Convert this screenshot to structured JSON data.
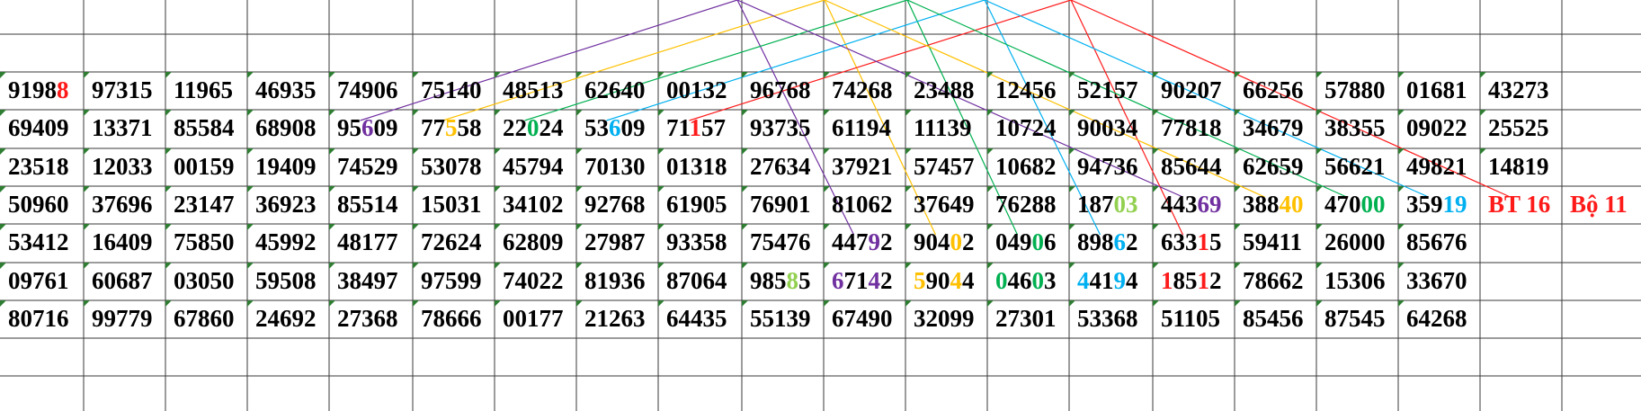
{
  "colors": {
    "red": "#ff1a1a",
    "purple": "#7030a0",
    "orange": "#ffc000",
    "green": "#00b050",
    "lightgreen": "#92d050",
    "cyan": "#00b0f0",
    "black": "#000000",
    "grid": "#3a3a3a"
  },
  "rows": [
    {
      "cells": [
        {
          "t": "91988",
          "hl": [
            [
              4,
              "red"
            ]
          ]
        },
        {
          "t": "97315"
        },
        {
          "t": "11965"
        },
        {
          "t": "46935"
        },
        {
          "t": "74906"
        },
        {
          "t": "75140"
        },
        {
          "t": "48513"
        },
        {
          "t": "62640"
        },
        {
          "t": "00132"
        },
        {
          "t": "96768"
        },
        {
          "t": "74268"
        },
        {
          "t": "23488"
        },
        {
          "t": "12456"
        },
        {
          "t": "52157"
        },
        {
          "t": "90207"
        },
        {
          "t": "66256"
        },
        {
          "t": "57880"
        },
        {
          "t": "01681"
        },
        {
          "t": "43273"
        }
      ]
    },
    {
      "cells": [
        {
          "t": "69409"
        },
        {
          "t": "13371"
        },
        {
          "t": "85584"
        },
        {
          "t": "68908"
        },
        {
          "t": "95609",
          "hl": [
            [
              2,
              "purple"
            ]
          ]
        },
        {
          "t": "77558",
          "hl": [
            [
              2,
              "orange"
            ]
          ]
        },
        {
          "t": "22024",
          "hl": [
            [
              2,
              "green"
            ]
          ]
        },
        {
          "t": "53609",
          "hl": [
            [
              2,
              "cyan"
            ]
          ]
        },
        {
          "t": "71157",
          "hl": [
            [
              2,
              "red"
            ]
          ]
        },
        {
          "t": "93735"
        },
        {
          "t": "61194"
        },
        {
          "t": "11139"
        },
        {
          "t": "10724"
        },
        {
          "t": "90034"
        },
        {
          "t": "77818"
        },
        {
          "t": "34679"
        },
        {
          "t": "38355"
        },
        {
          "t": "09022"
        },
        {
          "t": "25525"
        }
      ]
    },
    {
      "cells": [
        {
          "t": "23518"
        },
        {
          "t": "12033"
        },
        {
          "t": "00159"
        },
        {
          "t": "19409"
        },
        {
          "t": "74529"
        },
        {
          "t": "53078"
        },
        {
          "t": "45794"
        },
        {
          "t": "70130"
        },
        {
          "t": "01318"
        },
        {
          "t": "27634"
        },
        {
          "t": "37921"
        },
        {
          "t": "57457"
        },
        {
          "t": "10682"
        },
        {
          "t": "94736"
        },
        {
          "t": "85644"
        },
        {
          "t": "62659"
        },
        {
          "t": "56621"
        },
        {
          "t": "49821"
        },
        {
          "t": "14819"
        }
      ]
    },
    {
      "cells": [
        {
          "t": "50960"
        },
        {
          "t": "37696"
        },
        {
          "t": "23147"
        },
        {
          "t": "36923"
        },
        {
          "t": "85514"
        },
        {
          "t": "15031"
        },
        {
          "t": "34102"
        },
        {
          "t": "92768"
        },
        {
          "t": "61905"
        },
        {
          "t": "76901"
        },
        {
          "t": "81062"
        },
        {
          "t": "37649"
        },
        {
          "t": "76288"
        },
        {
          "t": "18703",
          "hl": [
            [
              3,
              "lightgreen"
            ],
            [
              4,
              "lightgreen"
            ]
          ]
        },
        {
          "t": "44369",
          "hl": [
            [
              3,
              "purple"
            ],
            [
              4,
              "purple"
            ]
          ]
        },
        {
          "t": "38840",
          "hl": [
            [
              3,
              "orange"
            ],
            [
              4,
              "orange"
            ]
          ]
        },
        {
          "t": "47000",
          "hl": [
            [
              3,
              "green"
            ],
            [
              4,
              "green"
            ]
          ]
        },
        {
          "t": "35919",
          "hl": [
            [
              3,
              "cyan"
            ],
            [
              4,
              "cyan"
            ]
          ]
        },
        {
          "t": "BT 16",
          "red": true
        },
        {
          "t": "Bộ 11",
          "red": true
        }
      ]
    },
    {
      "cells": [
        {
          "t": "53412"
        },
        {
          "t": "16409"
        },
        {
          "t": "75850"
        },
        {
          "t": "45992"
        },
        {
          "t": "48177"
        },
        {
          "t": "72624"
        },
        {
          "t": "62809"
        },
        {
          "t": "27987"
        },
        {
          "t": "93358"
        },
        {
          "t": "75476"
        },
        {
          "t": "44792",
          "hl": [
            [
              3,
              "purple"
            ]
          ]
        },
        {
          "t": "90402",
          "hl": [
            [
              3,
              "orange"
            ]
          ]
        },
        {
          "t": "04906",
          "hl": [
            [
              3,
              "green"
            ]
          ]
        },
        {
          "t": "89862",
          "hl": [
            [
              3,
              "cyan"
            ]
          ]
        },
        {
          "t": "63315",
          "hl": [
            [
              3,
              "red"
            ]
          ]
        },
        {
          "t": "59411"
        },
        {
          "t": "26000"
        },
        {
          "t": "85676"
        }
      ]
    },
    {
      "cells": [
        {
          "t": "09761"
        },
        {
          "t": "60687"
        },
        {
          "t": "03050"
        },
        {
          "t": "59508"
        },
        {
          "t": "38497"
        },
        {
          "t": "97599"
        },
        {
          "t": "74022"
        },
        {
          "t": "81936"
        },
        {
          "t": "87064"
        },
        {
          "t": "98585",
          "hl": [
            [
              3,
              "lightgreen"
            ]
          ]
        },
        {
          "t": "67142",
          "hl": [
            [
              0,
              "purple"
            ],
            [
              3,
              "purple"
            ]
          ]
        },
        {
          "t": "59044",
          "hl": [
            [
              0,
              "orange"
            ],
            [
              3,
              "orange"
            ]
          ]
        },
        {
          "t": "04603",
          "hl": [
            [
              0,
              "green"
            ],
            [
              3,
              "green"
            ]
          ]
        },
        {
          "t": "44194",
          "hl": [
            [
              0,
              "cyan"
            ],
            [
              3,
              "cyan"
            ]
          ]
        },
        {
          "t": "18512",
          "hl": [
            [
              0,
              "red"
            ],
            [
              3,
              "red"
            ]
          ]
        },
        {
          "t": "78662"
        },
        {
          "t": "15306"
        },
        {
          "t": "33670"
        }
      ]
    },
    {
      "cells": [
        {
          "t": "80716"
        },
        {
          "t": "99779"
        },
        {
          "t": "67860"
        },
        {
          "t": "24692"
        },
        {
          "t": "27368"
        },
        {
          "t": "78666"
        },
        {
          "t": "00177"
        },
        {
          "t": "21263"
        },
        {
          "t": "64435"
        },
        {
          "t": "55139"
        },
        {
          "t": "67490"
        },
        {
          "t": "32099"
        },
        {
          "t": "27301"
        },
        {
          "t": "53368"
        },
        {
          "t": "51105"
        },
        {
          "t": "85456"
        },
        {
          "t": "87545"
        },
        {
          "t": "64268"
        }
      ]
    }
  ],
  "connectors": [
    {
      "color": "purple",
      "apex": 0,
      "targets": [
        [
          1,
          4
        ],
        [
          4,
          10
        ]
      ]
    },
    {
      "color": "orange",
      "apex": 1,
      "targets": [
        [
          1,
          5
        ],
        [
          4,
          11
        ]
      ]
    },
    {
      "color": "green",
      "apex": 2,
      "targets": [
        [
          1,
          6
        ],
        [
          4,
          12
        ]
      ]
    },
    {
      "color": "cyan",
      "apex": 3,
      "targets": [
        [
          1,
          7
        ],
        [
          4,
          13
        ]
      ]
    },
    {
      "color": "red",
      "apex": 4,
      "targets": [
        [
          1,
          8
        ],
        [
          4,
          14
        ]
      ]
    },
    {
      "color": "purple",
      "apex": 0,
      "targets": [
        [
          3,
          14
        ]
      ]
    },
    {
      "color": "orange",
      "apex": 1,
      "targets": [
        [
          3,
          15
        ]
      ]
    },
    {
      "color": "green",
      "apex": 2,
      "targets": [
        [
          3,
          16
        ]
      ]
    },
    {
      "color": "cyan",
      "apex": 3,
      "targets": [
        [
          3,
          17
        ]
      ]
    },
    {
      "color": "red",
      "apex": 4,
      "targets": [
        [
          3,
          18
        ]
      ]
    }
  ]
}
